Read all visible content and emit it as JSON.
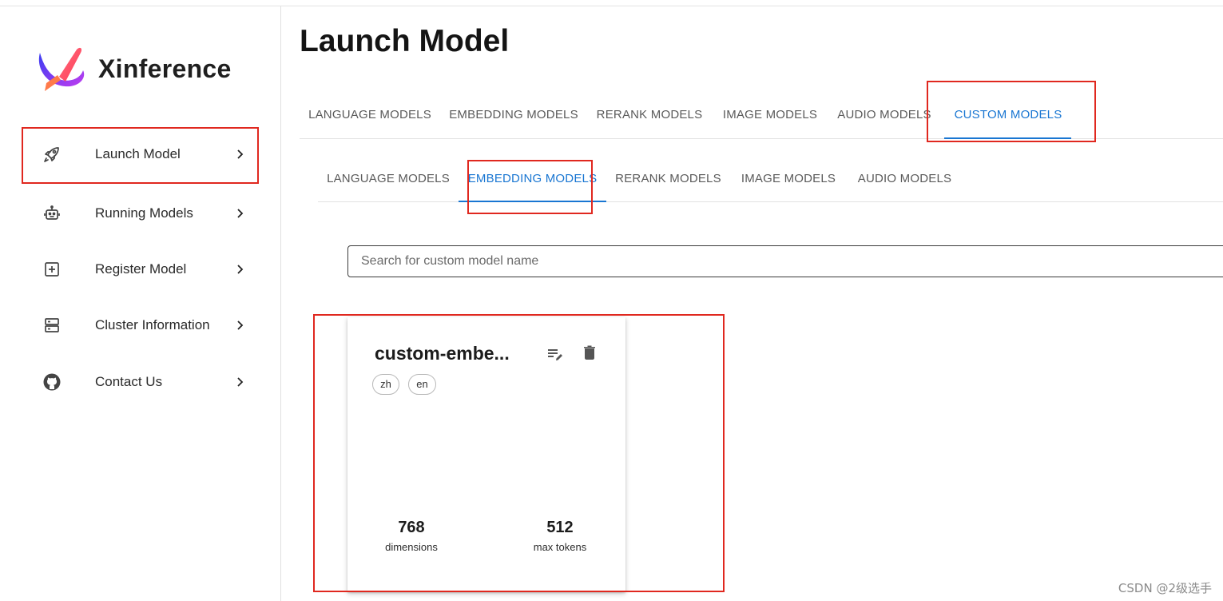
{
  "app": {
    "name": "Xinference"
  },
  "sidebar": {
    "items": [
      {
        "label": "Launch Model",
        "icon": "rocket-icon"
      },
      {
        "label": "Running Models",
        "icon": "robot-icon"
      },
      {
        "label": "Register Model",
        "icon": "plus-square-icon"
      },
      {
        "label": "Cluster Information",
        "icon": "server-icon"
      },
      {
        "label": "Contact Us",
        "icon": "github-icon"
      }
    ]
  },
  "main": {
    "title": "Launch Model",
    "tabs": [
      "LANGUAGE MODELS",
      "EMBEDDING MODELS",
      "RERANK MODELS",
      "IMAGE MODELS",
      "AUDIO MODELS",
      "CUSTOM MODELS"
    ],
    "active_tab": "CUSTOM MODELS",
    "sub_tabs": [
      "LANGUAGE MODELS",
      "EMBEDDING MODELS",
      "RERANK MODELS",
      "IMAGE MODELS",
      "AUDIO MODELS"
    ],
    "active_sub_tab": "EMBEDDING MODELS",
    "search": {
      "placeholder": "Search for custom model name",
      "value": ""
    },
    "cards": [
      {
        "name": "custom-embe...",
        "languages": [
          "zh",
          "en"
        ],
        "stats": [
          {
            "value": "768",
            "label": "dimensions"
          },
          {
            "value": "512",
            "label": "max tokens"
          }
        ]
      }
    ]
  },
  "watermark": "CSDN @2级选手",
  "colors": {
    "accent": "#1976d2",
    "highlight": "#e0281f"
  }
}
